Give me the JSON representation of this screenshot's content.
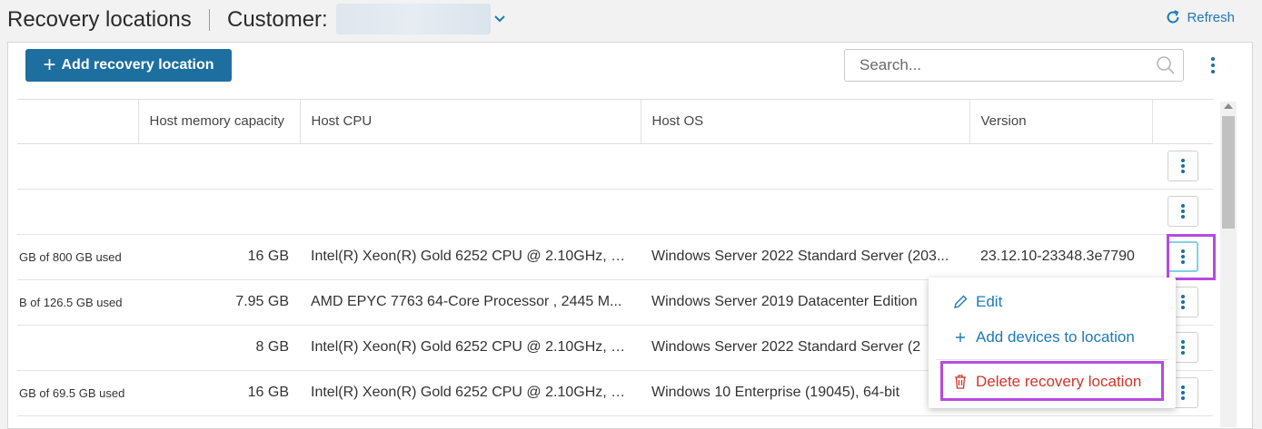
{
  "header": {
    "title": "Recovery locations",
    "customer_label": "Customer:",
    "refresh_label": "Refresh"
  },
  "toolbar": {
    "add_label": "Add recovery location",
    "search_placeholder": "Search..."
  },
  "table": {
    "columns": [
      "",
      "Host memory capacity",
      "Host CPU",
      "Host OS",
      "Version",
      ""
    ],
    "rows": [
      {
        "storage": "",
        "memory": "",
        "cpu": "",
        "os": "",
        "version": ""
      },
      {
        "storage": "",
        "memory": "",
        "cpu": "",
        "os": "",
        "version": ""
      },
      {
        "storage": "GB of 800 GB used",
        "memory": "16 GB",
        "cpu": "Intel(R) Xeon(R) Gold 6252 CPU @ 2.10GHz, 2...",
        "os": "Windows Server 2022 Standard Server (203...",
        "version": "23.12.10-23348.3e7790"
      },
      {
        "storage": "B of 126.5 GB used",
        "memory": "7.95 GB",
        "cpu": "AMD EPYC 7763 64-Core Processor , 2445 M...",
        "os": "Windows Server 2019 Datacenter Edition",
        "version": ""
      },
      {
        "storage": "",
        "memory": "8 GB",
        "cpu": "Intel(R) Xeon(R) Gold 6252 CPU @ 2.10GHz, 2...",
        "os": "Windows Server 2022 Standard Server (2",
        "version": ""
      },
      {
        "storage": "GB of 69.5 GB used",
        "memory": "16 GB",
        "cpu": "Intel(R) Xeon(R) Gold 6252 CPU @ 2.10GHz, 2...",
        "os": "Windows 10 Enterprise (19045), 64-bit",
        "version": ""
      }
    ]
  },
  "menu": {
    "edit": "Edit",
    "add_devices": "Add devices to location",
    "delete": "Delete recovery location"
  },
  "colors": {
    "accent": "#1d6f9f",
    "link": "#1d7ab8",
    "danger": "#d0352a",
    "highlight": "#b54be0"
  }
}
